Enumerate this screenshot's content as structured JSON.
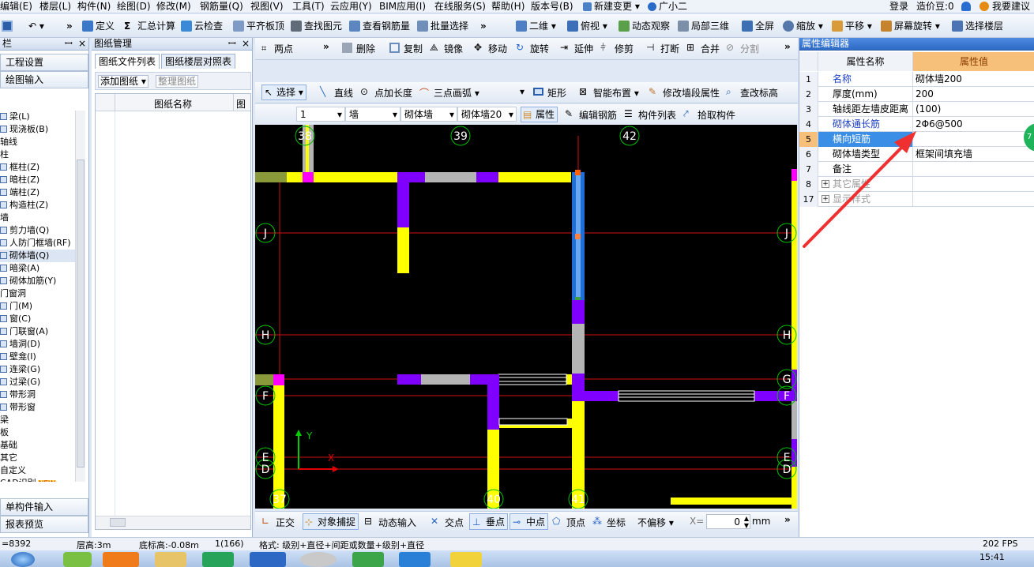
{
  "menu": [
    "编辑(E)",
    "楼层(L)",
    "构件(N)",
    "绘图(D)",
    "修改(M)",
    "钢筋量(Q)",
    "视图(V)",
    "工具(T)",
    "云应用(Y)",
    "BIM应用(I)",
    "在线服务(S)",
    "帮助(H)",
    "版本号(B)",
    "新建变更",
    "广小二"
  ],
  "menu_right": {
    "login": "登录",
    "price": "造价豆:0",
    "suggest": "我要建议"
  },
  "toolbar1": [
    "定义",
    "汇总计算",
    "云检查",
    "平齐板顶",
    "查找图元",
    "查看钢筋量",
    "批量选择",
    "二维",
    "俯视",
    "动态观察",
    "局部三维",
    "全屏",
    "缩放",
    "平移",
    "屏幕旋转",
    "选择楼层"
  ],
  "left_panel": {
    "title": "栏",
    "buttons": [
      "工程设置",
      "绘图输入"
    ],
    "tree": [
      {
        "label": "梁(L)",
        "type": "item"
      },
      {
        "label": "现浇板(B)",
        "type": "item"
      },
      {
        "label": "轴线",
        "type": "group"
      },
      {
        "label": "柱",
        "type": "group"
      },
      {
        "label": "框柱(Z)",
        "type": "item"
      },
      {
        "label": "暗柱(Z)",
        "type": "item"
      },
      {
        "label": "端柱(Z)",
        "type": "item"
      },
      {
        "label": "构造柱(Z)",
        "type": "item"
      },
      {
        "label": "墙",
        "type": "group"
      },
      {
        "label": "剪力墙(Q)",
        "type": "item"
      },
      {
        "label": "人防门框墙(RF)",
        "type": "item"
      },
      {
        "label": "砌体墙(Q)",
        "type": "item",
        "selected": true
      },
      {
        "label": "暗梁(A)",
        "type": "item"
      },
      {
        "label": "砌体加筋(Y)",
        "type": "item"
      },
      {
        "label": "门窗洞",
        "type": "group"
      },
      {
        "label": "门(M)",
        "type": "item"
      },
      {
        "label": "窗(C)",
        "type": "item"
      },
      {
        "label": "门联窗(A)",
        "type": "item"
      },
      {
        "label": "墙洞(D)",
        "type": "item"
      },
      {
        "label": "壁龛(I)",
        "type": "item"
      },
      {
        "label": "连梁(G)",
        "type": "item"
      },
      {
        "label": "过梁(G)",
        "type": "item"
      },
      {
        "label": "带形洞",
        "type": "item"
      },
      {
        "label": "带形窗",
        "type": "item"
      },
      {
        "label": "梁",
        "type": "group"
      },
      {
        "label": "板",
        "type": "group"
      },
      {
        "label": "基础",
        "type": "group"
      },
      {
        "label": "其它",
        "type": "group"
      },
      {
        "label": "自定义",
        "type": "group"
      },
      {
        "label": "CAD识别",
        "type": "group",
        "badge": "NEW"
      }
    ],
    "bottom_buttons": [
      "单构件输入",
      "报表预览"
    ]
  },
  "drawing_panel": {
    "title": "图纸管理",
    "tabs": [
      "图纸文件列表",
      "图纸楼层对照表"
    ],
    "buttons": [
      "添加图纸",
      "整理图纸"
    ],
    "columns": [
      "图纸名称",
      "图"
    ]
  },
  "canvas_toolbar1": [
    "两点",
    "删除",
    "复制",
    "镜像",
    "移动",
    "旋转",
    "延伸",
    "修剪",
    "打断",
    "合并",
    "分割"
  ],
  "canvas_toolbar2": [
    "选择",
    "直线",
    "点加长度",
    "三点画弧",
    "矩形",
    "智能布置",
    "修改墙段属性",
    "查改标高"
  ],
  "canvas_toolbar3": {
    "floor": "1",
    "category": "墙",
    "type": "砌体墙",
    "name": "砌体墙20",
    "actions": [
      "属性",
      "编辑钢筋",
      "构件列表",
      "拾取构件"
    ]
  },
  "axis_labels": {
    "top": [
      "38",
      "39",
      "42"
    ],
    "bottom": [
      "37",
      "40",
      "41"
    ],
    "left": [
      "J",
      "H",
      "F",
      "E",
      "D"
    ],
    "right": [
      "J",
      "H",
      "G",
      "F",
      "E",
      "D"
    ],
    "y_axis": "Y",
    "x_axis": "X"
  },
  "snap_bar": {
    "items": [
      "正交",
      "对象捕捉",
      "动态输入",
      "交点",
      "垂点",
      "中点",
      "顶点",
      "坐标"
    ],
    "offset_mode": "不偏移",
    "x_label": "X=",
    "x_value": "0",
    "unit": "mm"
  },
  "property_editor": {
    "title": "属性编辑器",
    "header_name": "属性名称",
    "header_value": "属性值",
    "rows": [
      {
        "num": "1",
        "name": "名称",
        "value": "砌体墙200",
        "blue": true
      },
      {
        "num": "2",
        "name": "厚度(mm)",
        "value": "200",
        "blue": false
      },
      {
        "num": "3",
        "name": "轴线距左墙皮距离",
        "value": "(100)",
        "blue": false
      },
      {
        "num": "4",
        "name": "砌体通长筋",
        "value": "2Φ6@500",
        "blue": true
      },
      {
        "num": "5",
        "name": "横向短筋",
        "value": "",
        "blue": true,
        "selected": true
      },
      {
        "num": "6",
        "name": "砌体墙类型",
        "value": "框架间填充墙",
        "blue": false
      },
      {
        "num": "7",
        "name": "备注",
        "value": "",
        "blue": false
      },
      {
        "num": "8",
        "name": "其它属性",
        "value": "",
        "blue": false,
        "group": true
      },
      {
        "num": "17",
        "name": "显示样式",
        "value": "",
        "blue": false,
        "group": true
      }
    ]
  },
  "status_bar": {
    "coord": "=8392",
    "floor_height": "层高:3m",
    "base_elev": "底标高:-0.08m",
    "count": "1(166)",
    "format": "格式: 级别+直径+间距或数量+级别+直径",
    "fps": "202 FPS"
  },
  "taskbar": {
    "time": "15:41"
  },
  "colors": {
    "wall_yellow": "#ffff00",
    "wall_purple": "#8000ff",
    "wall_gray": "#b4b4b4",
    "wall_blue": "#1e6fd8",
    "axis_red": "#e00000",
    "arrow_red": "#f03030"
  }
}
